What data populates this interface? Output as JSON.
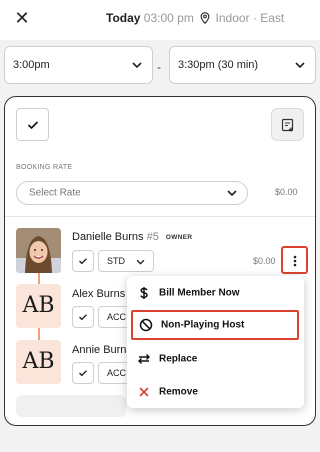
{
  "header": {
    "close_icon": "close-icon",
    "day": "Today",
    "time": "03:00 pm",
    "location": "Indoor · East"
  },
  "time_range": {
    "start": "3:00pm",
    "separator": "-",
    "end": "3:30pm (30 min)"
  },
  "booking": {
    "rate_label": "BOOKING RATE",
    "rate_placeholder": "Select Rate",
    "rate_amount": "$0.00"
  },
  "players": [
    {
      "name": "Danielle Burns",
      "number": "#5",
      "role": "OWNER",
      "rate_tag": "STD",
      "amount": "$0.00",
      "avatar": "photo"
    },
    {
      "name": "Alex Burns",
      "initials": "AB",
      "rate_tag": "ACC"
    },
    {
      "name": "Annie Burns",
      "initials": "AB",
      "rate_tag": "ACC"
    }
  ],
  "context_menu": {
    "items": [
      {
        "label": "Bill Member Now",
        "icon": "dollar-icon"
      },
      {
        "label": "Non-Playing Host",
        "icon": "block-icon",
        "highlighted": true
      },
      {
        "label": "Replace",
        "icon": "swap-icon"
      },
      {
        "label": "Remove",
        "icon": "x-icon",
        "color": "#d9432f"
      }
    ]
  },
  "colors": {
    "highlight": "#d9432f",
    "initials_bg": "#fbe4da",
    "connector": "#f2a07a"
  }
}
